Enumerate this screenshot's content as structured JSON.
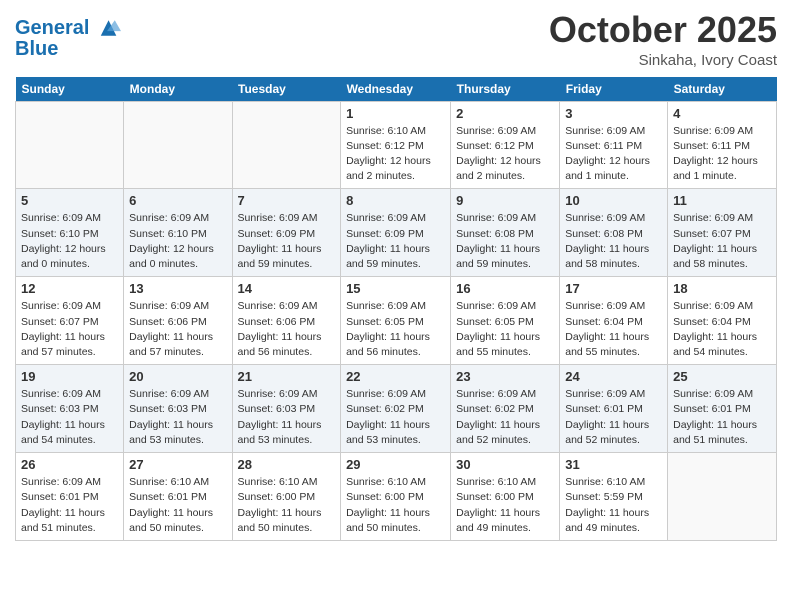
{
  "header": {
    "logo_line1": "General",
    "logo_line2": "Blue",
    "month": "October 2025",
    "location": "Sinkaha, Ivory Coast"
  },
  "weekdays": [
    "Sunday",
    "Monday",
    "Tuesday",
    "Wednesday",
    "Thursday",
    "Friday",
    "Saturday"
  ],
  "weeks": [
    [
      {
        "day": "",
        "info": ""
      },
      {
        "day": "",
        "info": ""
      },
      {
        "day": "",
        "info": ""
      },
      {
        "day": "1",
        "info": "Sunrise: 6:10 AM\nSunset: 6:12 PM\nDaylight: 12 hours and 2 minutes."
      },
      {
        "day": "2",
        "info": "Sunrise: 6:09 AM\nSunset: 6:12 PM\nDaylight: 12 hours and 2 minutes."
      },
      {
        "day": "3",
        "info": "Sunrise: 6:09 AM\nSunset: 6:11 PM\nDaylight: 12 hours and 1 minute."
      },
      {
        "day": "4",
        "info": "Sunrise: 6:09 AM\nSunset: 6:11 PM\nDaylight: 12 hours and 1 minute."
      }
    ],
    [
      {
        "day": "5",
        "info": "Sunrise: 6:09 AM\nSunset: 6:10 PM\nDaylight: 12 hours and 0 minutes."
      },
      {
        "day": "6",
        "info": "Sunrise: 6:09 AM\nSunset: 6:10 PM\nDaylight: 12 hours and 0 minutes."
      },
      {
        "day": "7",
        "info": "Sunrise: 6:09 AM\nSunset: 6:09 PM\nDaylight: 11 hours and 59 minutes."
      },
      {
        "day": "8",
        "info": "Sunrise: 6:09 AM\nSunset: 6:09 PM\nDaylight: 11 hours and 59 minutes."
      },
      {
        "day": "9",
        "info": "Sunrise: 6:09 AM\nSunset: 6:08 PM\nDaylight: 11 hours and 59 minutes."
      },
      {
        "day": "10",
        "info": "Sunrise: 6:09 AM\nSunset: 6:08 PM\nDaylight: 11 hours and 58 minutes."
      },
      {
        "day": "11",
        "info": "Sunrise: 6:09 AM\nSunset: 6:07 PM\nDaylight: 11 hours and 58 minutes."
      }
    ],
    [
      {
        "day": "12",
        "info": "Sunrise: 6:09 AM\nSunset: 6:07 PM\nDaylight: 11 hours and 57 minutes."
      },
      {
        "day": "13",
        "info": "Sunrise: 6:09 AM\nSunset: 6:06 PM\nDaylight: 11 hours and 57 minutes."
      },
      {
        "day": "14",
        "info": "Sunrise: 6:09 AM\nSunset: 6:06 PM\nDaylight: 11 hours and 56 minutes."
      },
      {
        "day": "15",
        "info": "Sunrise: 6:09 AM\nSunset: 6:05 PM\nDaylight: 11 hours and 56 minutes."
      },
      {
        "day": "16",
        "info": "Sunrise: 6:09 AM\nSunset: 6:05 PM\nDaylight: 11 hours and 55 minutes."
      },
      {
        "day": "17",
        "info": "Sunrise: 6:09 AM\nSunset: 6:04 PM\nDaylight: 11 hours and 55 minutes."
      },
      {
        "day": "18",
        "info": "Sunrise: 6:09 AM\nSunset: 6:04 PM\nDaylight: 11 hours and 54 minutes."
      }
    ],
    [
      {
        "day": "19",
        "info": "Sunrise: 6:09 AM\nSunset: 6:03 PM\nDaylight: 11 hours and 54 minutes."
      },
      {
        "day": "20",
        "info": "Sunrise: 6:09 AM\nSunset: 6:03 PM\nDaylight: 11 hours and 53 minutes."
      },
      {
        "day": "21",
        "info": "Sunrise: 6:09 AM\nSunset: 6:03 PM\nDaylight: 11 hours and 53 minutes."
      },
      {
        "day": "22",
        "info": "Sunrise: 6:09 AM\nSunset: 6:02 PM\nDaylight: 11 hours and 53 minutes."
      },
      {
        "day": "23",
        "info": "Sunrise: 6:09 AM\nSunset: 6:02 PM\nDaylight: 11 hours and 52 minutes."
      },
      {
        "day": "24",
        "info": "Sunrise: 6:09 AM\nSunset: 6:01 PM\nDaylight: 11 hours and 52 minutes."
      },
      {
        "day": "25",
        "info": "Sunrise: 6:09 AM\nSunset: 6:01 PM\nDaylight: 11 hours and 51 minutes."
      }
    ],
    [
      {
        "day": "26",
        "info": "Sunrise: 6:09 AM\nSunset: 6:01 PM\nDaylight: 11 hours and 51 minutes."
      },
      {
        "day": "27",
        "info": "Sunrise: 6:10 AM\nSunset: 6:01 PM\nDaylight: 11 hours and 50 minutes."
      },
      {
        "day": "28",
        "info": "Sunrise: 6:10 AM\nSunset: 6:00 PM\nDaylight: 11 hours and 50 minutes."
      },
      {
        "day": "29",
        "info": "Sunrise: 6:10 AM\nSunset: 6:00 PM\nDaylight: 11 hours and 50 minutes."
      },
      {
        "day": "30",
        "info": "Sunrise: 6:10 AM\nSunset: 6:00 PM\nDaylight: 11 hours and 49 minutes."
      },
      {
        "day": "31",
        "info": "Sunrise: 6:10 AM\nSunset: 5:59 PM\nDaylight: 11 hours and 49 minutes."
      },
      {
        "day": "",
        "info": ""
      }
    ]
  ]
}
